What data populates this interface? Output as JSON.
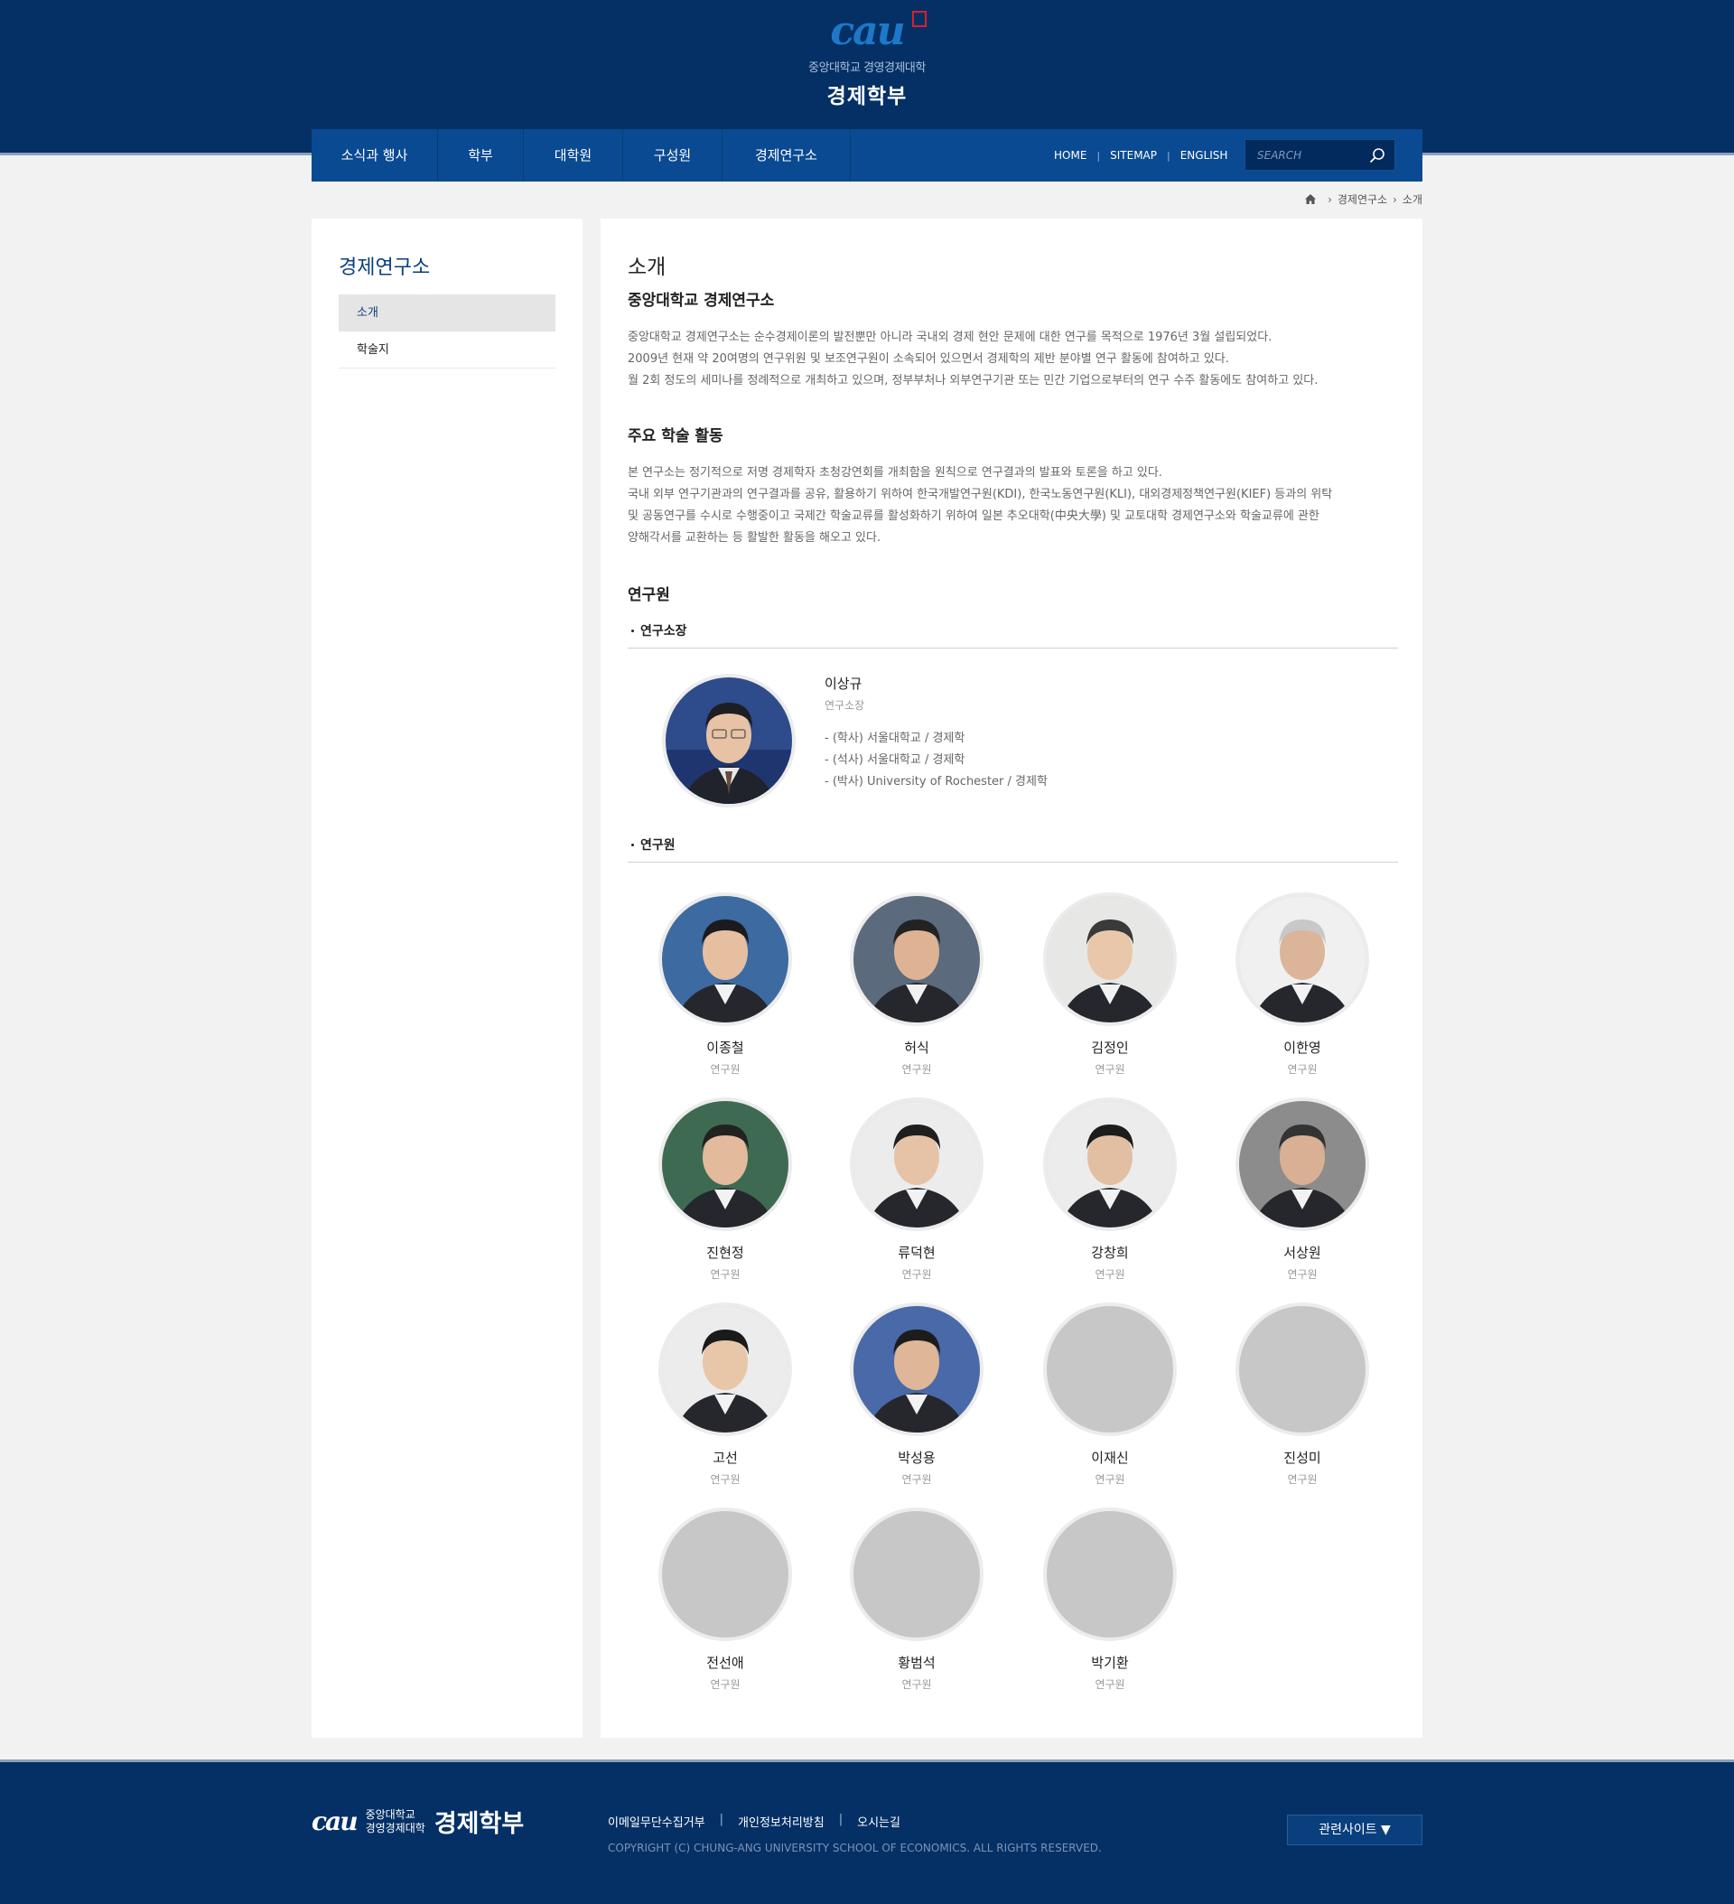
{
  "header": {
    "logo_mark": "cau",
    "university": "중앙대학교 경영경제대학",
    "department": "경제학부"
  },
  "nav": {
    "menu": [
      "소식과 행사",
      "학부",
      "대학원",
      "구성원",
      "경제연구소"
    ],
    "util": [
      "HOME",
      "SITEMAP",
      "ENGLISH"
    ],
    "search_placeholder": "SEARCH"
  },
  "breadcrumb": [
    "경제연구소",
    "소개"
  ],
  "sidebar": {
    "title": "경제연구소",
    "items": [
      {
        "label": "소개",
        "active": true
      },
      {
        "label": "학술지",
        "active": false
      }
    ]
  },
  "content": {
    "title": "소개",
    "heading1": "중앙대학교 경제연구소",
    "intro": [
      "중앙대학교 경제연구소는 순수경제이론의 발전뿐만 아니라 국내외 경제 현안 문제에 대한 연구를 목적으로 1976년 3월 설립되었다.",
      "2009년 현재 약 20여명의 연구위원 및 보조연구원이 소속되어 있으면서 경제학의 제반 분야별 연구 활동에 참여하고 있다.",
      "월 2회 정도의 세미나를 정례적으로 개최하고 있으며, 정부부처나 외부연구기관 또는 민간 기업으로부터의 연구 수주 활동에도 참여하고 있다."
    ],
    "heading2": "주요 학술 활동",
    "activities": [
      "본 연구소는 정기적으로 저명 경제학자 초청강연회를 개최함을 원칙으로 연구결과의 발표와 토론을 하고 있다.",
      "국내 외부 연구기관과의 연구결과를 공유, 활용하기 위하여 한국개발연구원(KDI), 한국노동연구원(KLI), 대외경제정책연구원(KIEF) 등과의 위탁",
      "및 공동연구를 수시로 수행중이고 국제간 학술교류를 활성화하기 위하여 일본 추오대학(中央大學) 및 교토대학 경제연구소와 학술교류에 관한",
      "양해각서를 교환하는 등 활발한 활동을 해오고 있다."
    ],
    "heading3": "연구원",
    "director_section": "연구소장",
    "director": {
      "name": "이상규",
      "role": "연구소장",
      "education": [
        "- (학사) 서울대학교 / 경제학",
        "- (석사) 서울대학교 / 경제학",
        "- (박사) University of Rochester / 경제학"
      ]
    },
    "members_section": "연구원",
    "members": [
      {
        "name": "이종철",
        "role": "연구원",
        "photo": true
      },
      {
        "name": "허식",
        "role": "연구원",
        "photo": true
      },
      {
        "name": "김정인",
        "role": "연구원",
        "photo": true
      },
      {
        "name": "이한영",
        "role": "연구원",
        "photo": true
      },
      {
        "name": "진현정",
        "role": "연구원",
        "photo": true
      },
      {
        "name": "류덕현",
        "role": "연구원",
        "photo": true
      },
      {
        "name": "강창희",
        "role": "연구원",
        "photo": true
      },
      {
        "name": "서상원",
        "role": "연구원",
        "photo": true
      },
      {
        "name": "고선",
        "role": "연구원",
        "photo": true
      },
      {
        "name": "박성용",
        "role": "연구원",
        "photo": true
      },
      {
        "name": "이재신",
        "role": "연구원",
        "photo": false
      },
      {
        "name": "진성미",
        "role": "연구원",
        "photo": false
      },
      {
        "name": "전선애",
        "role": "연구원",
        "photo": false
      },
      {
        "name": "황범석",
        "role": "연구원",
        "photo": false
      },
      {
        "name": "박기환",
        "role": "연구원",
        "photo": false
      }
    ]
  },
  "footer": {
    "logo_mark": "cau",
    "university_line1": "중앙대학교",
    "university_line2": "경영경제대학",
    "department": "경제학부",
    "links": [
      "이메일무단수집거부",
      "개인정보처리방침",
      "오시는길"
    ],
    "copyright": "COPYRIGHT (C) CHUNG-ANG UNIVERSITY SCHOOL OF ECONOMICS.  ALL RIGHTS RESERVED.",
    "related_sites": "관련사이트 ▼"
  },
  "colors": {
    "header_bg": "#043065",
    "nav_bg": "#0a4a92",
    "accent": "#0b3f7d",
    "placeholder_photo": "#c7c7c7"
  }
}
